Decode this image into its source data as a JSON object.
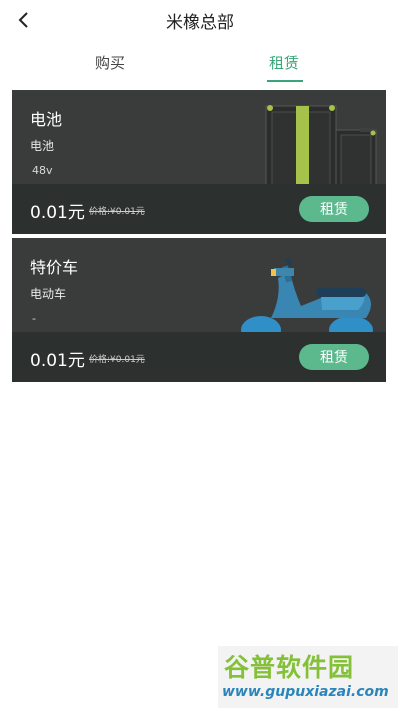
{
  "header": {
    "title": "米橡总部",
    "back_icon": "chevron-left-icon"
  },
  "tabs": [
    {
      "label": "购买",
      "active": false
    },
    {
      "label": "租赁",
      "active": true
    }
  ],
  "colors": {
    "accent": "#3aa57a",
    "button": "#5cb98e",
    "card_bg": "#3a3c3c",
    "card_footer": "#2c302f"
  },
  "cards": [
    {
      "name": "电池",
      "subtitle": "电池",
      "spec": "48v",
      "price": "0.01元",
      "original_price": "价格:¥0.01元",
      "button_label": "租赁",
      "image": "battery-illustration"
    },
    {
      "name": "特价车",
      "subtitle": "电动车",
      "spec": "-",
      "price": "0.01元",
      "original_price": "价格:¥0.01元",
      "button_label": "租赁",
      "image": "scooter-illustration"
    }
  ],
  "watermark": {
    "text": "谷普软件园",
    "url": "www.gupuxiazai.com"
  }
}
